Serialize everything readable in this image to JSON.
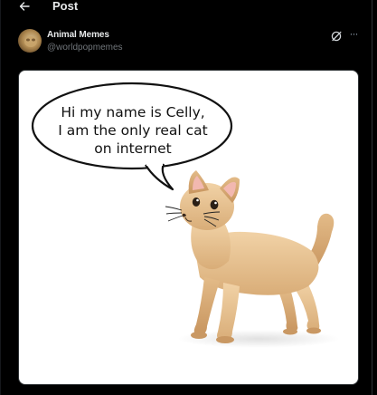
{
  "header": {
    "title": "Post",
    "back_icon": "arrow-left-icon"
  },
  "post": {
    "author_name": "Animal Memes",
    "author_handle": "@worldpopmemes",
    "actions": {
      "grok_icon": "grok-icon",
      "more_icon": "more-icon",
      "more_glyph": "···"
    },
    "media": {
      "speech_bubble_text": "Hi my name is Celly,\nI am the only real cat\non internet"
    }
  },
  "colors": {
    "background": "#000000",
    "text_primary": "#e7e9ea",
    "text_secondary": "#71767b",
    "divider": "#2f3336"
  }
}
